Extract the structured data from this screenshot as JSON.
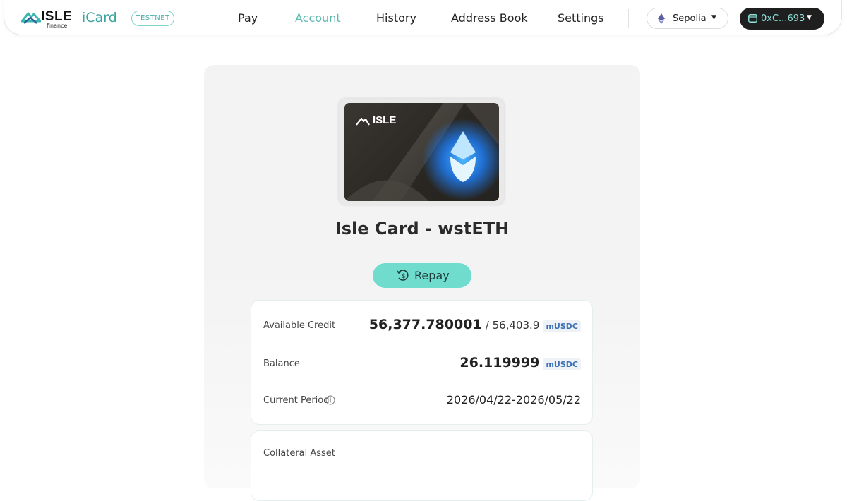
{
  "brand": {
    "logo_text": "ISLE",
    "logo_sub": "finance",
    "product": "iCard",
    "env_badge": "TESTNET"
  },
  "nav": {
    "items": [
      {
        "label": "Pay",
        "active": false
      },
      {
        "label": "Account",
        "active": true
      },
      {
        "label": "History",
        "active": false
      },
      {
        "label": "Address Book",
        "active": false
      },
      {
        "label": "Settings",
        "active": false
      }
    ]
  },
  "network": {
    "label": "Sepolia",
    "icon": "ethereum-icon"
  },
  "wallet": {
    "label": "0xC...693",
    "icon": "wallet-icon"
  },
  "card": {
    "brand_text": "ISLE",
    "title": "Isle Card - wstETH"
  },
  "repay": {
    "label": "Repay",
    "icon": "repay-icon"
  },
  "info": {
    "available_credit": {
      "label": "Available Credit",
      "value": "56,377.780001",
      "limit": "/ 56,403.9",
      "unit": "mUSDC"
    },
    "balance": {
      "label": "Balance",
      "value": "26.119999",
      "unit": "mUSDC"
    },
    "current_period": {
      "label": "Current Period",
      "value": "2026/04/22-2026/05/22",
      "icon": "info-icon"
    }
  },
  "collateral": {
    "label": "Collateral Asset"
  },
  "colors": {
    "accent": "#6fdcce",
    "active_nav": "#5cbab3",
    "unit_text": "#3b6fb4"
  }
}
